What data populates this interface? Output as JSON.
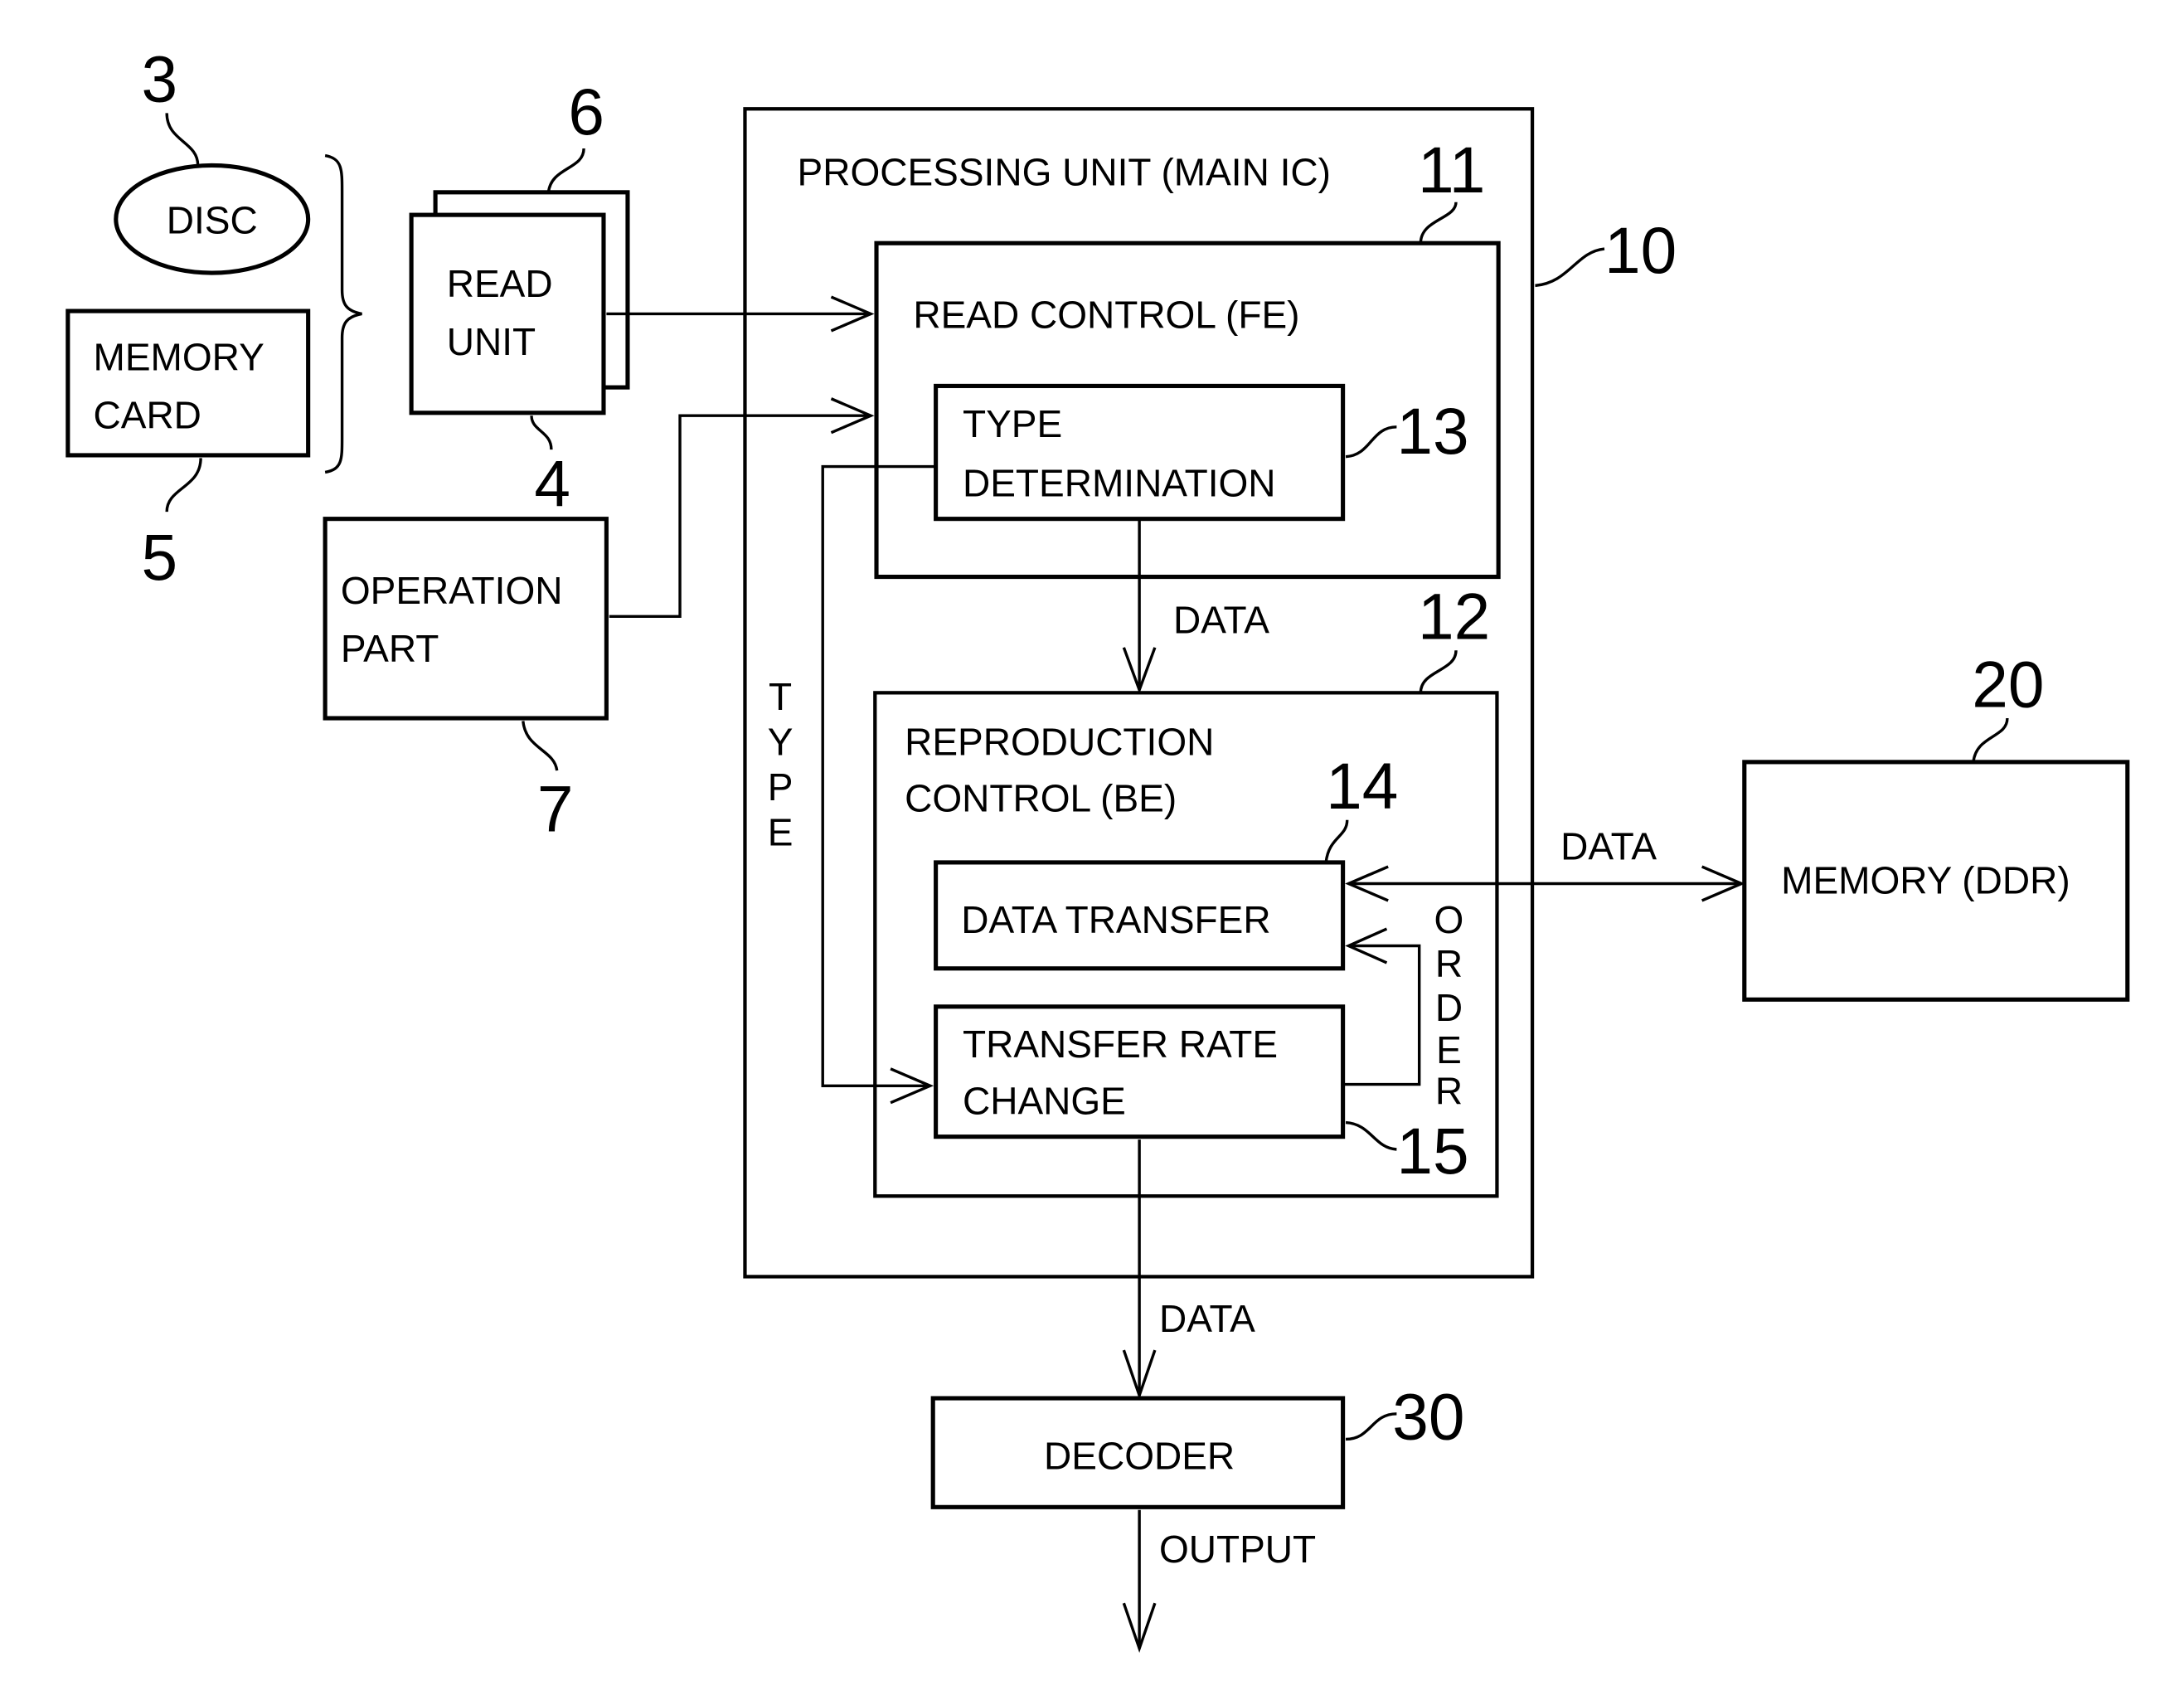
{
  "figure": {
    "blocks": {
      "disc": {
        "label": "DISC",
        "ref": "3"
      },
      "memory_card": {
        "label_lines": [
          "MEMORY",
          "CARD"
        ],
        "ref": "5"
      },
      "read_unit": {
        "label_lines": [
          "READ",
          "UNIT"
        ],
        "ref_front": "4",
        "ref_back": "6"
      },
      "operation_part": {
        "label_lines": [
          "OPERATION",
          "PART"
        ],
        "ref": "7"
      },
      "processing_unit": {
        "label": "PROCESSING UNIT (MAIN IC)",
        "ref": "10"
      },
      "read_control": {
        "label": "READ CONTROL (FE)",
        "ref": "11"
      },
      "type_determination": {
        "label_lines": [
          "TYPE",
          "DETERMINATION"
        ],
        "ref": "13"
      },
      "reproduction_control": {
        "label_lines": [
          "REPRODUCTION",
          "CONTROL (BE)"
        ],
        "ref": "12"
      },
      "data_transfer": {
        "label": "DATA TRANSFER",
        "ref": "14"
      },
      "transfer_rate_change": {
        "label_lines": [
          "TRANSFER RATE",
          "CHANGE"
        ],
        "ref": "15"
      },
      "memory_ddr": {
        "label": "MEMORY (DDR)",
        "ref": "20"
      },
      "decoder": {
        "label": "DECODER",
        "ref": "30"
      }
    },
    "signals": {
      "data_fe_to_be": "DATA",
      "type": [
        "T",
        "Y",
        "P",
        "E"
      ],
      "order": [
        "O",
        "R",
        "D",
        "E",
        "R"
      ],
      "data_memory": "DATA",
      "data_to_decoder": "DATA",
      "output": "OUTPUT"
    }
  }
}
